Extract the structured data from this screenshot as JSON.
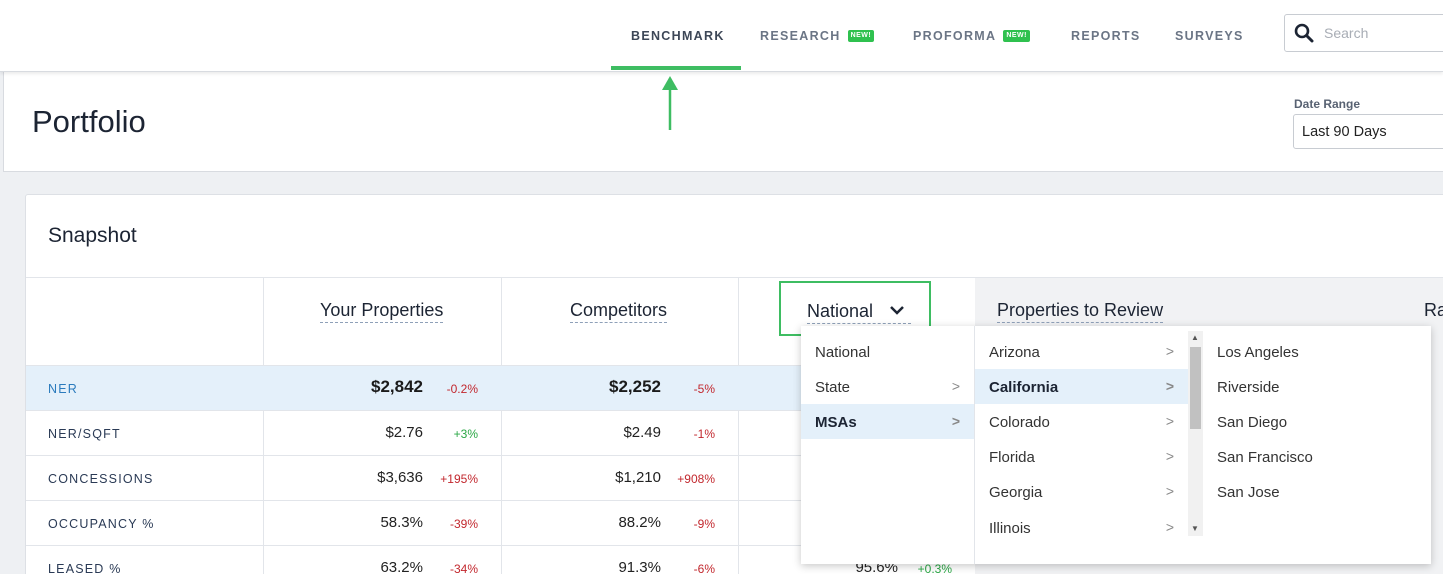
{
  "nav": {
    "items": [
      {
        "label": "BENCHMARK",
        "badge": ""
      },
      {
        "label": "RESEARCH",
        "badge": "NEW!"
      },
      {
        "label": "PROFORMA",
        "badge": "NEW!"
      },
      {
        "label": "REPORTS",
        "badge": ""
      },
      {
        "label": "SURVEYS",
        "badge": ""
      }
    ],
    "active": "BENCHMARK",
    "search_placeholder": "Search"
  },
  "header": {
    "title": "Portfolio",
    "date_range_label": "Date Range",
    "date_range_value": "Last 90 Days"
  },
  "snapshot": {
    "title": "Snapshot",
    "columns": {
      "your_properties": "Your Properties",
      "competitors": "Competitors",
      "national": "National",
      "properties_to_review": "Properties to Review",
      "cut_off": "Ra"
    },
    "rows": [
      {
        "label": "NER",
        "yours": "$2,842",
        "yours_pct": "-0.2%",
        "comp": "$2,252",
        "comp_pct": "-5%"
      },
      {
        "label": "NER/SQFT",
        "yours": "$2.76",
        "yours_pct": "+3%",
        "comp": "$2.49",
        "comp_pct": "-1%"
      },
      {
        "label": "CONCESSIONS",
        "yours": "$3,636",
        "yours_pct": "+195%",
        "comp": "$1,210",
        "comp_pct": "+908%"
      },
      {
        "label": "OCCUPANCY %",
        "yours": "58.3%",
        "yours_pct": "-39%",
        "comp": "88.2%",
        "comp_pct": "-9%"
      },
      {
        "label": "LEASED %",
        "yours": "63.2%",
        "yours_pct": "-34%",
        "comp": "91.3%",
        "comp_pct": "-6%",
        "nat": "95.6%",
        "nat_pct": "+0.3%"
      }
    ]
  },
  "dropdown": {
    "level1": [
      {
        "label": "National",
        "chevron": ""
      },
      {
        "label": "State",
        "chevron": ">"
      },
      {
        "label": "MSAs",
        "chevron": ">"
      }
    ],
    "level1_selected": "MSAs",
    "level2": [
      {
        "label": "Arizona",
        "chevron": ">"
      },
      {
        "label": "California",
        "chevron": ">"
      },
      {
        "label": "Colorado",
        "chevron": ">"
      },
      {
        "label": "Florida",
        "chevron": ">"
      },
      {
        "label": "Georgia",
        "chevron": ">"
      },
      {
        "label": "Illinois",
        "chevron": ">"
      }
    ],
    "level2_selected": "California",
    "level3": [
      "Los Angeles",
      "Riverside",
      "San Diego",
      "San Francisco",
      "San Jose"
    ]
  },
  "colors": {
    "accent_green": "#3ebd62",
    "negative": "#c2272d",
    "positive": "#2aa745",
    "highlight": "#e4f0fa"
  }
}
